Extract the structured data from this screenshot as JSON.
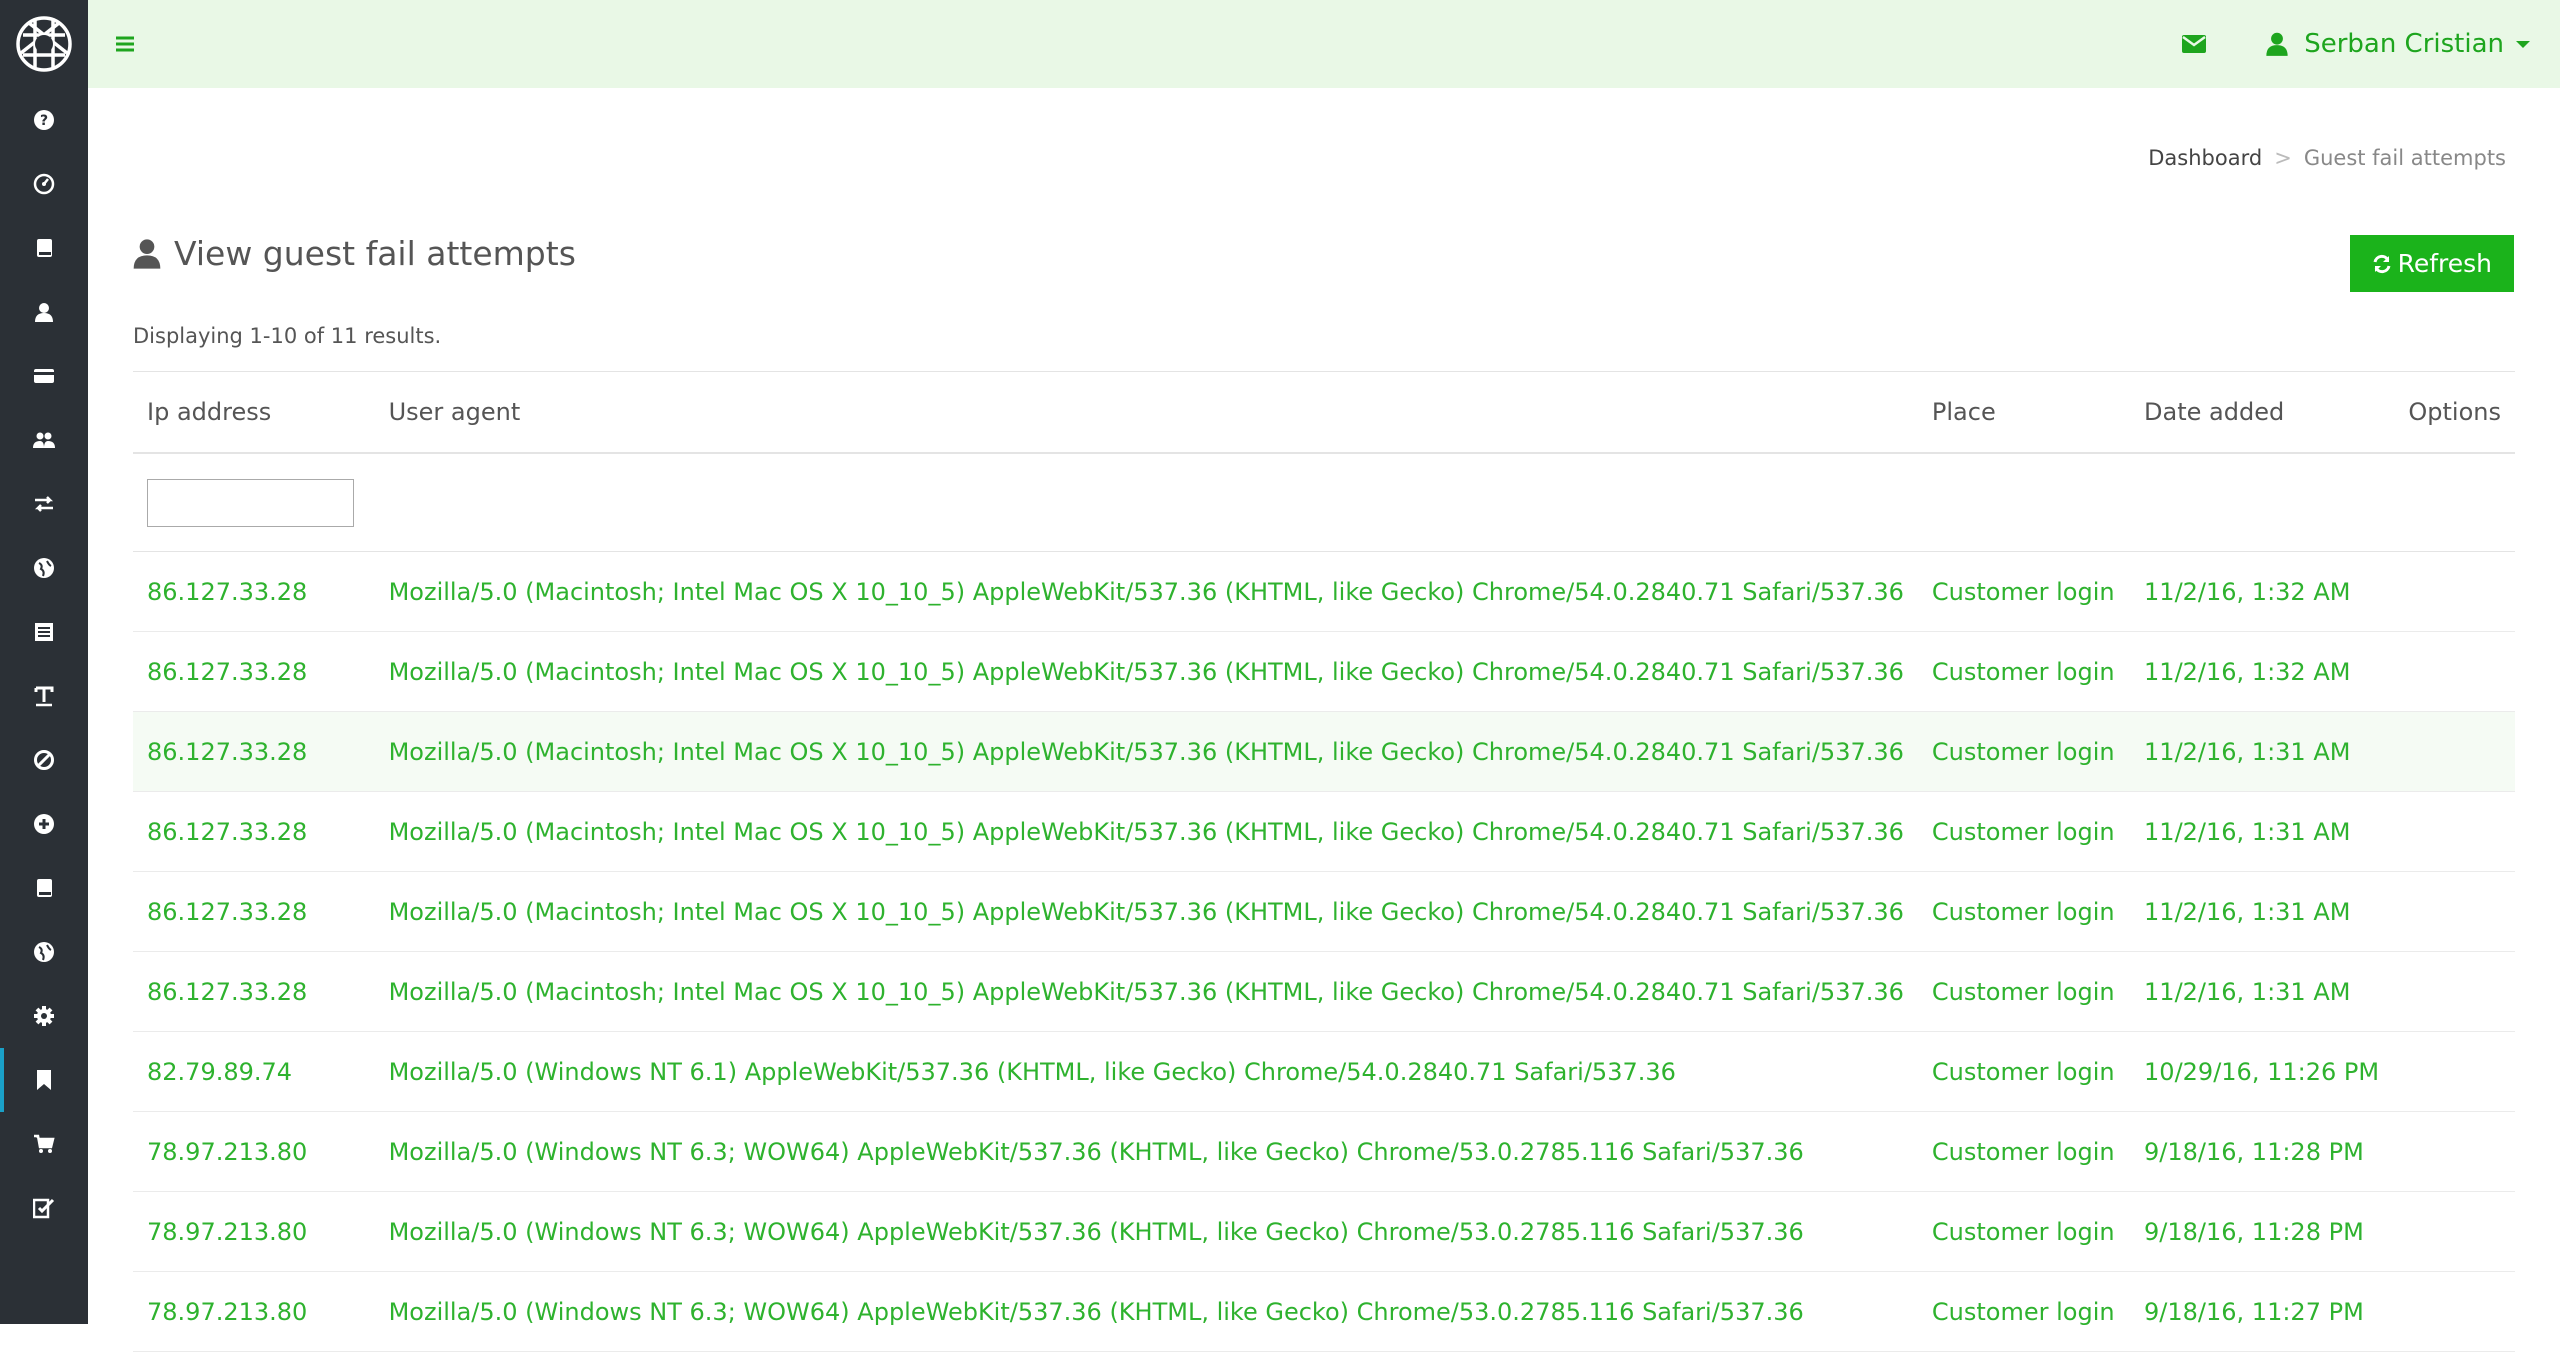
{
  "sidebar": {
    "logo": "aperture-logo",
    "items": [
      {
        "icon": "question-circle-icon",
        "active": false
      },
      {
        "icon": "dashboard-gauge-icon",
        "active": false
      },
      {
        "icon": "book-icon",
        "active": false
      },
      {
        "icon": "user-icon",
        "active": false
      },
      {
        "icon": "credit-card-icon",
        "active": false
      },
      {
        "icon": "users-icon",
        "active": false
      },
      {
        "icon": "exchange-icon",
        "active": false
      },
      {
        "icon": "globe-icon",
        "active": false
      },
      {
        "icon": "list-alt-icon",
        "active": false
      },
      {
        "icon": "text-icon",
        "active": false
      },
      {
        "icon": "ban-icon",
        "active": false
      },
      {
        "icon": "plus-circle-icon",
        "active": false
      },
      {
        "icon": "book-icon",
        "active": false
      },
      {
        "icon": "globe-icon",
        "active": false
      },
      {
        "icon": "gear-icon",
        "active": false
      },
      {
        "icon": "bookmark-icon",
        "active": true
      },
      {
        "icon": "shopping-cart-icon",
        "active": false
      },
      {
        "icon": "edit-check-icon",
        "active": false
      }
    ]
  },
  "topbar": {
    "user_name": "Serban Cristian",
    "accent_color": "#1ea51e",
    "background": "#e9f8e6"
  },
  "breadcrumb": {
    "home": "Dashboard",
    "separator": ">",
    "current": "Guest fail attempts"
  },
  "page": {
    "title": "View guest fail attempts",
    "refresh_label": "Refresh",
    "summary": "Displaying 1-10 of 11 results."
  },
  "table": {
    "columns": {
      "ip": "Ip address",
      "user_agent": "User agent",
      "place": "Place",
      "date": "Date added",
      "options": "Options"
    },
    "filter_ip_value": "",
    "rows": [
      {
        "ip": "86.127.33.28",
        "ua": "Mozilla/5.0 (Macintosh; Intel Mac OS X 10_10_5) AppleWebKit/537.36 (KHTML, like Gecko) Chrome/54.0.2840.71 Safari/537.36",
        "place": "Customer login",
        "date": "11/2/16, 1:32 AM"
      },
      {
        "ip": "86.127.33.28",
        "ua": "Mozilla/5.0 (Macintosh; Intel Mac OS X 10_10_5) AppleWebKit/537.36 (KHTML, like Gecko) Chrome/54.0.2840.71 Safari/537.36",
        "place": "Customer login",
        "date": "11/2/16, 1:32 AM"
      },
      {
        "ip": "86.127.33.28",
        "ua": "Mozilla/5.0 (Macintosh; Intel Mac OS X 10_10_5) AppleWebKit/537.36 (KHTML, like Gecko) Chrome/54.0.2840.71 Safari/537.36",
        "place": "Customer login",
        "date": "11/2/16, 1:31 AM"
      },
      {
        "ip": "86.127.33.28",
        "ua": "Mozilla/5.0 (Macintosh; Intel Mac OS X 10_10_5) AppleWebKit/537.36 (KHTML, like Gecko) Chrome/54.0.2840.71 Safari/537.36",
        "place": "Customer login",
        "date": "11/2/16, 1:31 AM"
      },
      {
        "ip": "86.127.33.28",
        "ua": "Mozilla/5.0 (Macintosh; Intel Mac OS X 10_10_5) AppleWebKit/537.36 (KHTML, like Gecko) Chrome/54.0.2840.71 Safari/537.36",
        "place": "Customer login",
        "date": "11/2/16, 1:31 AM"
      },
      {
        "ip": "86.127.33.28",
        "ua": "Mozilla/5.0 (Macintosh; Intel Mac OS X 10_10_5) AppleWebKit/537.36 (KHTML, like Gecko) Chrome/54.0.2840.71 Safari/537.36",
        "place": "Customer login",
        "date": "11/2/16, 1:31 AM"
      },
      {
        "ip": "82.79.89.74",
        "ua": "Mozilla/5.0 (Windows NT 6.1) AppleWebKit/537.36 (KHTML, like Gecko) Chrome/54.0.2840.71 Safari/537.36",
        "place": "Customer login",
        "date": "10/29/16, 11:26 PM"
      },
      {
        "ip": "78.97.213.80",
        "ua": "Mozilla/5.0 (Windows NT 6.3; WOW64) AppleWebKit/537.36 (KHTML, like Gecko) Chrome/53.0.2785.116 Safari/537.36",
        "place": "Customer login",
        "date": "9/18/16, 11:28 PM"
      },
      {
        "ip": "78.97.213.80",
        "ua": "Mozilla/5.0 (Windows NT 6.3; WOW64) AppleWebKit/537.36 (KHTML, like Gecko) Chrome/53.0.2785.116 Safari/537.36",
        "place": "Customer login",
        "date": "9/18/16, 11:28 PM"
      },
      {
        "ip": "78.97.213.80",
        "ua": "Mozilla/5.0 (Windows NT 6.3; WOW64) AppleWebKit/537.36 (KHTML, like Gecko) Chrome/53.0.2785.116 Safari/537.36",
        "place": "Customer login",
        "date": "9/18/16, 11:27 PM"
      }
    ],
    "highlighted_row_index": 2
  }
}
